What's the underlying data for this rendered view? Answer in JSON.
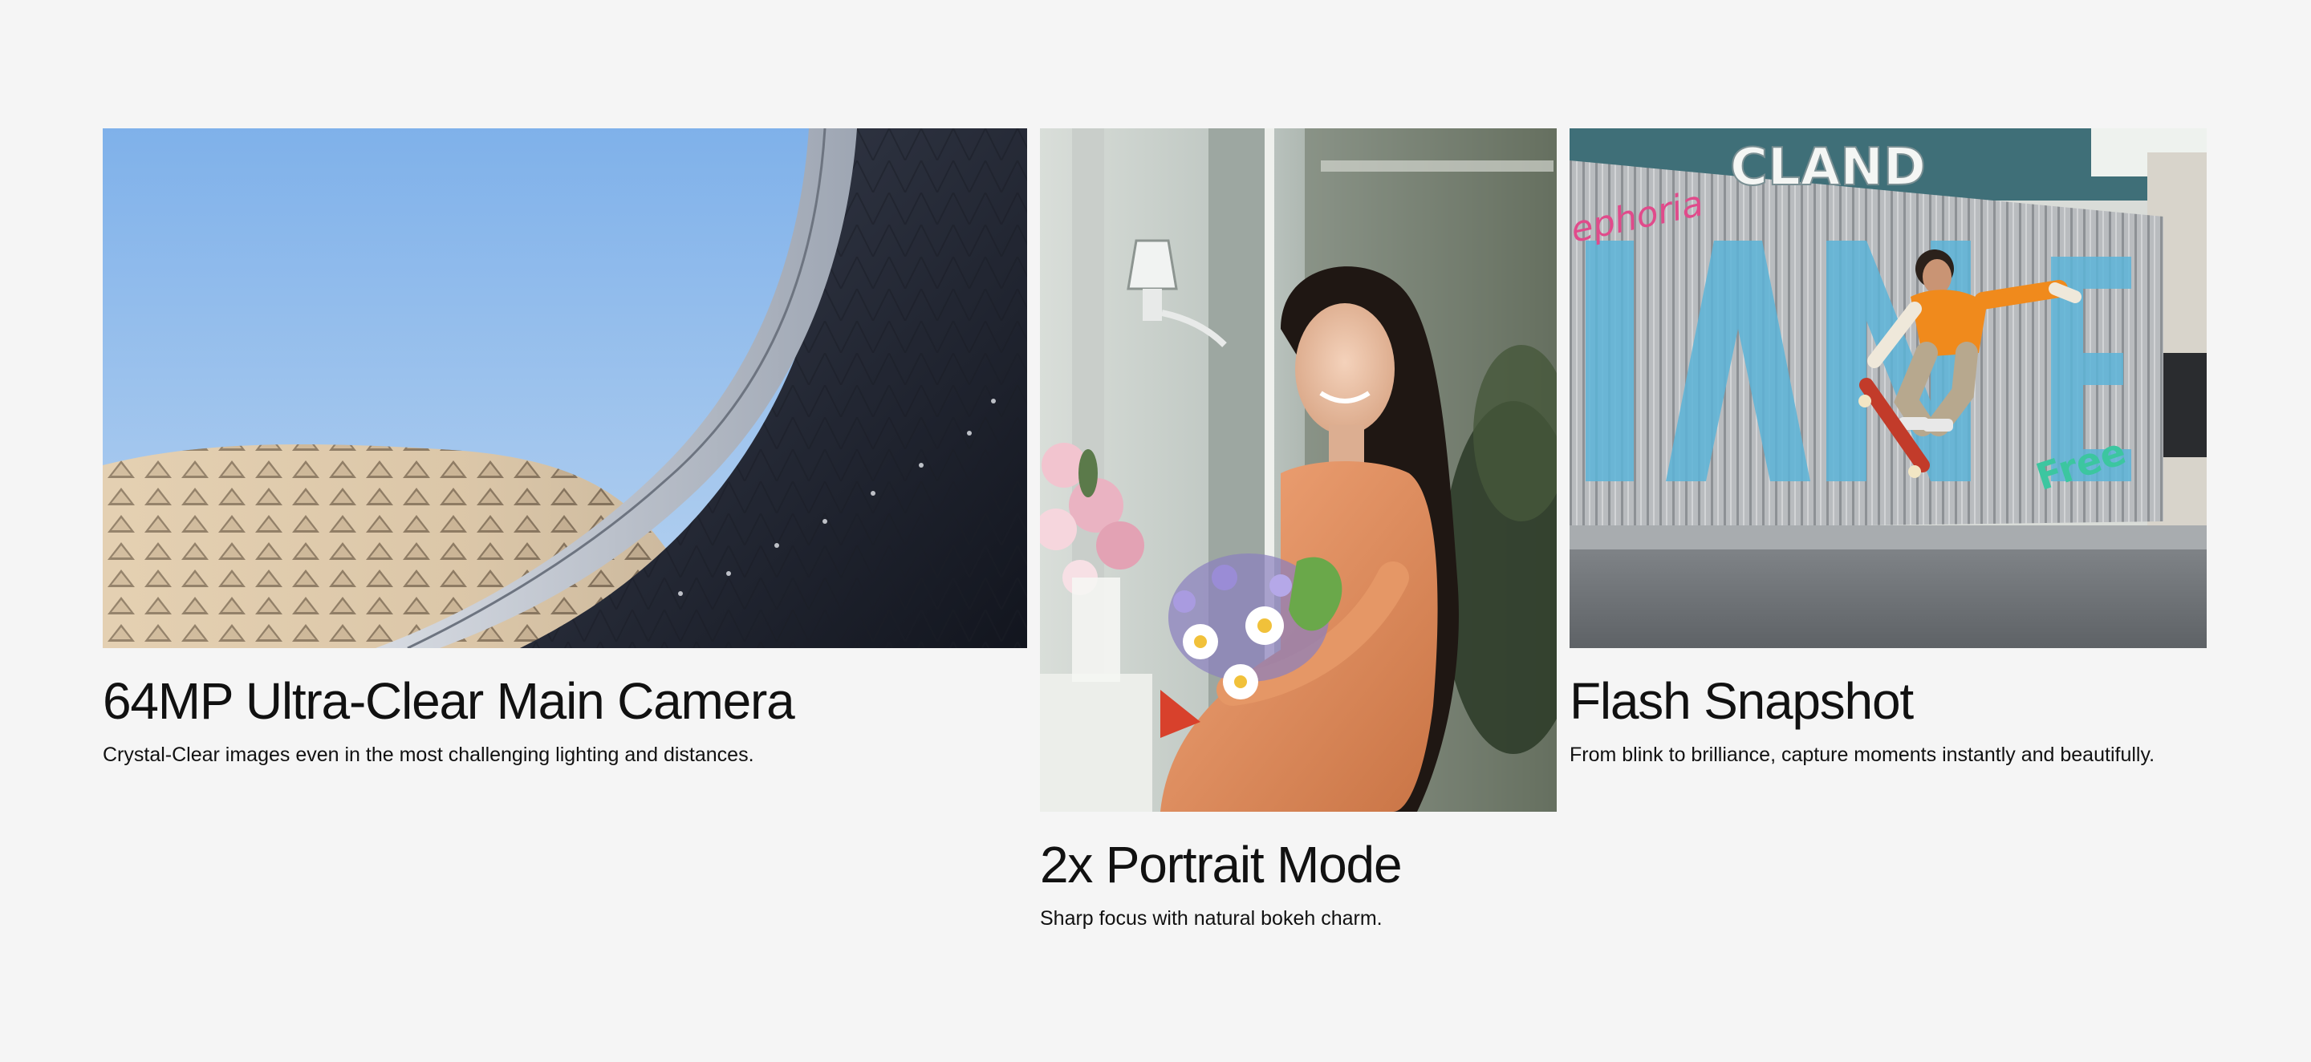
{
  "features": [
    {
      "title": "64MP Ultra-Clear Main Camera",
      "description": "Crystal-Clear images even in the most challenging lighting and distances."
    },
    {
      "title": "2x Portrait Mode",
      "description": "Sharp focus with natural bokeh charm."
    },
    {
      "title": "Flash Snapshot",
      "description": "From blink to brilliance, capture moments instantly and beautifully."
    }
  ],
  "colors": {
    "background": "#f5f5f5",
    "text": "#111111"
  }
}
